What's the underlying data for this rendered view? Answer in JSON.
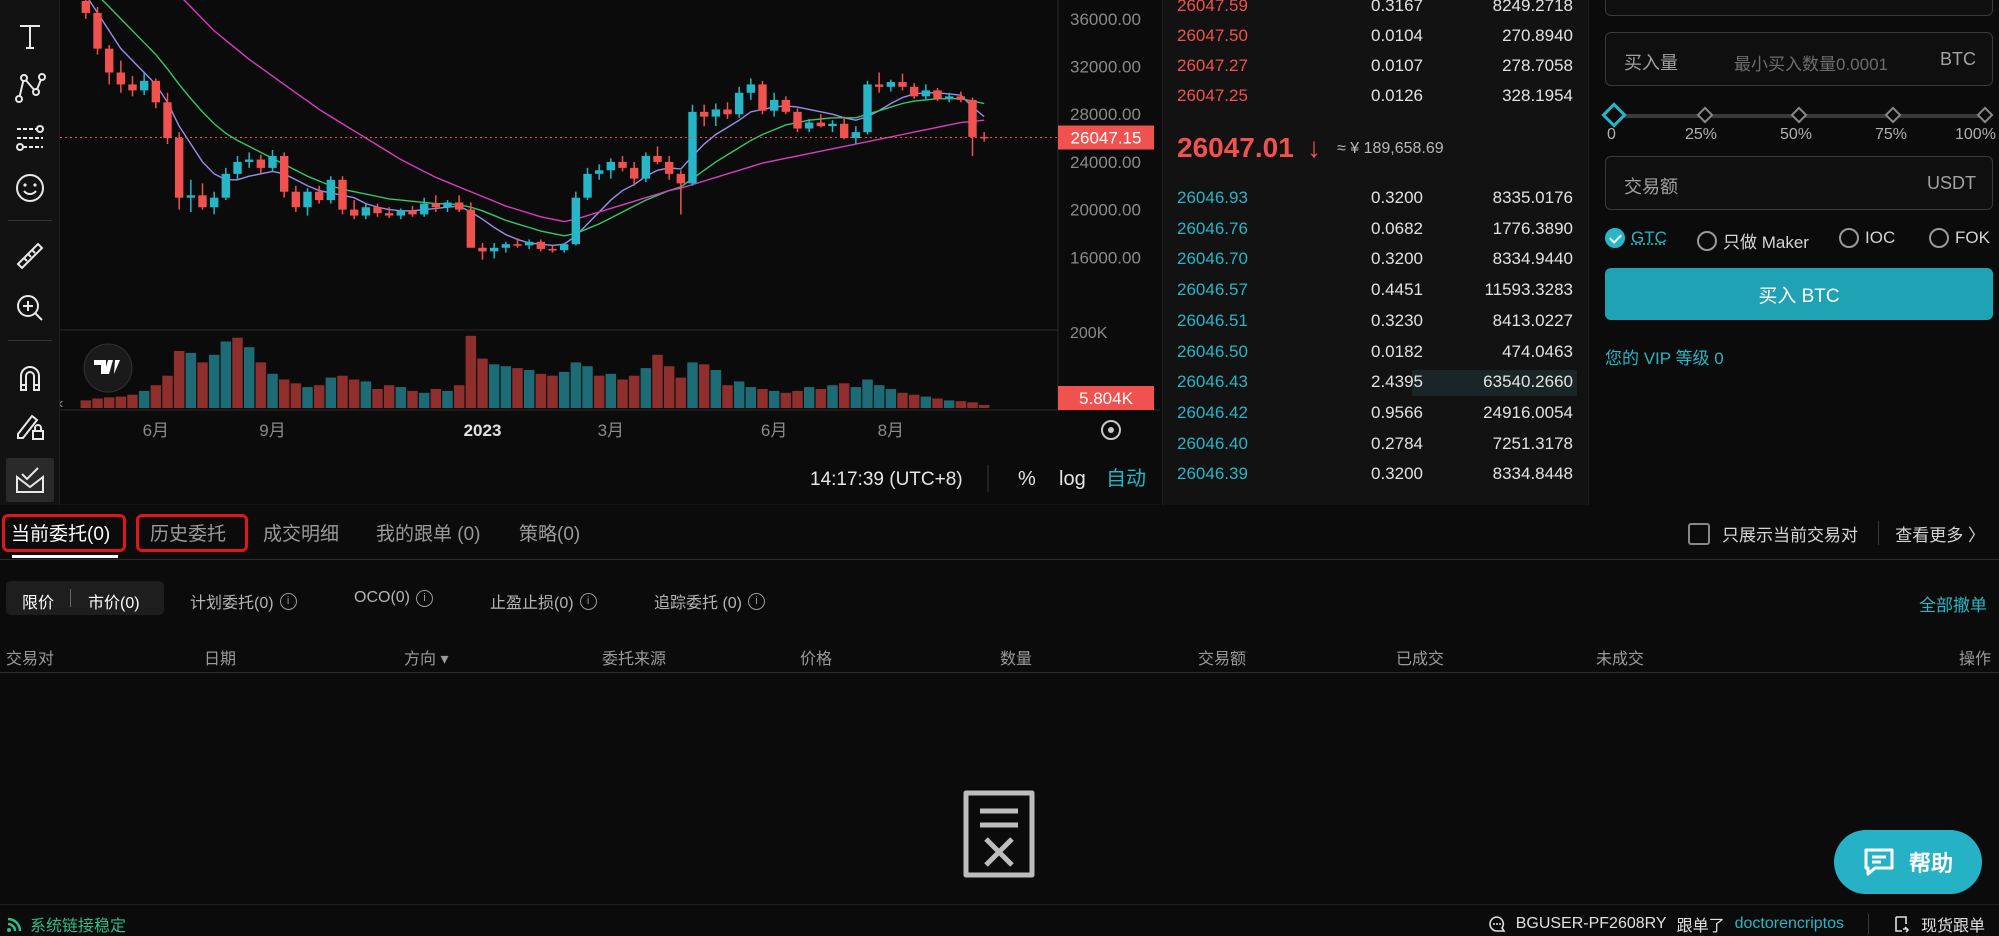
{
  "colors": {
    "up": "#26b6c7",
    "down": "#f0524f",
    "accent": "#26b6c7",
    "red_box": "#e0161b"
  },
  "toolbar": {
    "icons": [
      "text-icon",
      "node-path-icon",
      "fib-lines-icon",
      "smiley-icon",
      "ruler-icon",
      "zoom-in-icon",
      "magnet-icon",
      "pencil-lock-icon",
      "envelope-icon"
    ]
  },
  "chart": {
    "price_axis": [
      "36000.00",
      "32000.00",
      "28000.00",
      "24000.00",
      "20000.00",
      "16000.00"
    ],
    "last_price_label": "26047.15",
    "volume_axis_label": "200K",
    "volume_label": "5.804K",
    "time_axis": [
      "6月",
      "9月",
      "2023",
      "3月",
      "6月",
      "8月"
    ],
    "clock": "14:17:39 (UTC+8)",
    "scale_buttons": [
      "%",
      "log",
      "自动"
    ]
  },
  "chart_data": {
    "type": "candlestick",
    "ylim": [
      14000,
      37000
    ],
    "candles": [
      {
        "o": 37500,
        "h": 38500,
        "l": 36000,
        "c": 36500
      },
      {
        "o": 36500,
        "h": 37000,
        "l": 33000,
        "c": 33500
      },
      {
        "o": 33500,
        "h": 33800,
        "l": 30500,
        "c": 31500
      },
      {
        "o": 31500,
        "h": 32500,
        "l": 29800,
        "c": 30500
      },
      {
        "o": 30500,
        "h": 31200,
        "l": 29500,
        "c": 30000
      },
      {
        "o": 30000,
        "h": 31500,
        "l": 29600,
        "c": 30800
      },
      {
        "o": 30800,
        "h": 31000,
        "l": 28500,
        "c": 29000
      },
      {
        "o": 29000,
        "h": 29800,
        "l": 25500,
        "c": 26000
      },
      {
        "o": 26000,
        "h": 26500,
        "l": 20000,
        "c": 21000
      },
      {
        "o": 21000,
        "h": 22500,
        "l": 19800,
        "c": 21200
      },
      {
        "o": 21200,
        "h": 22200,
        "l": 20000,
        "c": 20200
      },
      {
        "o": 20200,
        "h": 21500,
        "l": 19600,
        "c": 21000
      },
      {
        "o": 21000,
        "h": 23500,
        "l": 20800,
        "c": 23000
      },
      {
        "o": 23000,
        "h": 24500,
        "l": 22500,
        "c": 24000
      },
      {
        "o": 24000,
        "h": 24800,
        "l": 23500,
        "c": 24200
      },
      {
        "o": 24200,
        "h": 24600,
        "l": 23000,
        "c": 23500
      },
      {
        "o": 23500,
        "h": 25000,
        "l": 23200,
        "c": 24500
      },
      {
        "o": 24500,
        "h": 24800,
        "l": 21000,
        "c": 21500
      },
      {
        "o": 21500,
        "h": 22000,
        "l": 19800,
        "c": 20200
      },
      {
        "o": 20200,
        "h": 21800,
        "l": 19500,
        "c": 21500
      },
      {
        "o": 21500,
        "h": 22000,
        "l": 20500,
        "c": 20800
      },
      {
        "o": 20800,
        "h": 22800,
        "l": 20500,
        "c": 22500
      },
      {
        "o": 22500,
        "h": 22800,
        "l": 19600,
        "c": 20000
      },
      {
        "o": 20000,
        "h": 20800,
        "l": 19200,
        "c": 19500
      },
      {
        "o": 19500,
        "h": 20500,
        "l": 19200,
        "c": 20200
      },
      {
        "o": 20200,
        "h": 20500,
        "l": 19400,
        "c": 19700
      },
      {
        "o": 19700,
        "h": 20200,
        "l": 19300,
        "c": 19500
      },
      {
        "o": 19500,
        "h": 20100,
        "l": 19200,
        "c": 19900
      },
      {
        "o": 19900,
        "h": 20300,
        "l": 19400,
        "c": 19600
      },
      {
        "o": 19600,
        "h": 21000,
        "l": 19400,
        "c": 20500
      },
      {
        "o": 20500,
        "h": 21200,
        "l": 19800,
        "c": 20200
      },
      {
        "o": 20200,
        "h": 20800,
        "l": 19800,
        "c": 20600
      },
      {
        "o": 20600,
        "h": 21200,
        "l": 19800,
        "c": 20000
      },
      {
        "o": 20000,
        "h": 20600,
        "l": 17500,
        "c": 16800
      },
      {
        "o": 16800,
        "h": 17200,
        "l": 15800,
        "c": 16500
      },
      {
        "o": 16500,
        "h": 17200,
        "l": 15900,
        "c": 16800
      },
      {
        "o": 16800,
        "h": 17300,
        "l": 16400,
        "c": 17100
      },
      {
        "o": 17100,
        "h": 17600,
        "l": 16800,
        "c": 17000
      },
      {
        "o": 17000,
        "h": 17500,
        "l": 16700,
        "c": 17300
      },
      {
        "o": 17300,
        "h": 17500,
        "l": 16500,
        "c": 16700
      },
      {
        "o": 16700,
        "h": 17000,
        "l": 16400,
        "c": 16600
      },
      {
        "o": 16600,
        "h": 17200,
        "l": 16400,
        "c": 17100
      },
      {
        "o": 17100,
        "h": 21500,
        "l": 17000,
        "c": 21000
      },
      {
        "o": 21000,
        "h": 23500,
        "l": 20800,
        "c": 23000
      },
      {
        "o": 23000,
        "h": 23800,
        "l": 22500,
        "c": 23300
      },
      {
        "o": 23300,
        "h": 24300,
        "l": 22600,
        "c": 24000
      },
      {
        "o": 24000,
        "h": 24500,
        "l": 23200,
        "c": 23500
      },
      {
        "o": 23500,
        "h": 24000,
        "l": 22000,
        "c": 22600
      },
      {
        "o": 22600,
        "h": 24800,
        "l": 22300,
        "c": 24500
      },
      {
        "o": 24500,
        "h": 25300,
        "l": 23800,
        "c": 24000
      },
      {
        "o": 24000,
        "h": 24500,
        "l": 22500,
        "c": 23000
      },
      {
        "o": 23000,
        "h": 23300,
        "l": 19600,
        "c": 22200
      },
      {
        "o": 22200,
        "h": 28800,
        "l": 22000,
        "c": 28200
      },
      {
        "o": 28200,
        "h": 28800,
        "l": 27000,
        "c": 27800
      },
      {
        "o": 27800,
        "h": 28900,
        "l": 27000,
        "c": 28400
      },
      {
        "o": 28400,
        "h": 29000,
        "l": 27600,
        "c": 28000
      },
      {
        "o": 28000,
        "h": 30300,
        "l": 27700,
        "c": 29800
      },
      {
        "o": 29800,
        "h": 31000,
        "l": 29200,
        "c": 30500
      },
      {
        "o": 30500,
        "h": 30800,
        "l": 28000,
        "c": 28300
      },
      {
        "o": 28300,
        "h": 29800,
        "l": 27800,
        "c": 29200
      },
      {
        "o": 29200,
        "h": 29500,
        "l": 28000,
        "c": 28200
      },
      {
        "o": 28200,
        "h": 28500,
        "l": 26500,
        "c": 26800
      },
      {
        "o": 26800,
        "h": 27600,
        "l": 26500,
        "c": 27300
      },
      {
        "o": 27300,
        "h": 28000,
        "l": 26900,
        "c": 27000
      },
      {
        "o": 27000,
        "h": 27500,
        "l": 26500,
        "c": 27200
      },
      {
        "o": 27200,
        "h": 27800,
        "l": 25900,
        "c": 26000
      },
      {
        "o": 26000,
        "h": 27000,
        "l": 25500,
        "c": 26500
      },
      {
        "o": 26500,
        "h": 30800,
        "l": 26300,
        "c": 30500
      },
      {
        "o": 30500,
        "h": 31500,
        "l": 29800,
        "c": 30300
      },
      {
        "o": 30300,
        "h": 30900,
        "l": 29900,
        "c": 30700
      },
      {
        "o": 30700,
        "h": 31400,
        "l": 30000,
        "c": 30300
      },
      {
        "o": 30300,
        "h": 30600,
        "l": 29300,
        "c": 29500
      },
      {
        "o": 29500,
        "h": 30500,
        "l": 29200,
        "c": 30000
      },
      {
        "o": 30000,
        "h": 30200,
        "l": 29100,
        "c": 29300
      },
      {
        "o": 29300,
        "h": 29800,
        "l": 29000,
        "c": 29500
      },
      {
        "o": 29500,
        "h": 29900,
        "l": 29000,
        "c": 29200
      },
      {
        "o": 29200,
        "h": 29400,
        "l": 24500,
        "c": 26100
      },
      {
        "o": 26100,
        "h": 26500,
        "l": 25700,
        "c": 26000
      }
    ],
    "volume": [
      {
        "v": 20,
        "up": false
      },
      {
        "v": 25,
        "up": false
      },
      {
        "v": 28,
        "up": false
      },
      {
        "v": 30,
        "up": false
      },
      {
        "v": 35,
        "up": false
      },
      {
        "v": 45,
        "up": true
      },
      {
        "v": 60,
        "up": false
      },
      {
        "v": 85,
        "up": false
      },
      {
        "v": 150,
        "up": false
      },
      {
        "v": 145,
        "up": true
      },
      {
        "v": 120,
        "up": false
      },
      {
        "v": 140,
        "up": true
      },
      {
        "v": 175,
        "up": true
      },
      {
        "v": 185,
        "up": false
      },
      {
        "v": 160,
        "up": true
      },
      {
        "v": 120,
        "up": false
      },
      {
        "v": 90,
        "up": true
      },
      {
        "v": 75,
        "up": false
      },
      {
        "v": 65,
        "up": false
      },
      {
        "v": 55,
        "up": true
      },
      {
        "v": 60,
        "up": false
      },
      {
        "v": 80,
        "up": true
      },
      {
        "v": 85,
        "up": false
      },
      {
        "v": 75,
        "up": false
      },
      {
        "v": 70,
        "up": true
      },
      {
        "v": 50,
        "up": false
      },
      {
        "v": 60,
        "up": false
      },
      {
        "v": 55,
        "up": true
      },
      {
        "v": 45,
        "up": false
      },
      {
        "v": 40,
        "up": true
      },
      {
        "v": 50,
        "up": false
      },
      {
        "v": 45,
        "up": true
      },
      {
        "v": 60,
        "up": false
      },
      {
        "v": 190,
        "up": false
      },
      {
        "v": 130,
        "up": false
      },
      {
        "v": 115,
        "up": true
      },
      {
        "v": 110,
        "up": true
      },
      {
        "v": 105,
        "up": false
      },
      {
        "v": 100,
        "up": true
      },
      {
        "v": 90,
        "up": false
      },
      {
        "v": 85,
        "up": false
      },
      {
        "v": 95,
        "up": true
      },
      {
        "v": 120,
        "up": true
      },
      {
        "v": 110,
        "up": true
      },
      {
        "v": 85,
        "up": false
      },
      {
        "v": 90,
        "up": true
      },
      {
        "v": 75,
        "up": false
      },
      {
        "v": 85,
        "up": false
      },
      {
        "v": 105,
        "up": true
      },
      {
        "v": 140,
        "up": false
      },
      {
        "v": 110,
        "up": false
      },
      {
        "v": 80,
        "up": false
      },
      {
        "v": 120,
        "up": true
      },
      {
        "v": 115,
        "up": false
      },
      {
        "v": 100,
        "up": true
      },
      {
        "v": 60,
        "up": false
      },
      {
        "v": 70,
        "up": true
      },
      {
        "v": 55,
        "up": true
      },
      {
        "v": 50,
        "up": false
      },
      {
        "v": 45,
        "up": true
      },
      {
        "v": 40,
        "up": false
      },
      {
        "v": 45,
        "up": false
      },
      {
        "v": 55,
        "up": true
      },
      {
        "v": 50,
        "up": false
      },
      {
        "v": 60,
        "up": true
      },
      {
        "v": 65,
        "up": false
      },
      {
        "v": 55,
        "up": true
      },
      {
        "v": 75,
        "up": true
      },
      {
        "v": 60,
        "up": true
      },
      {
        "v": 50,
        "up": true
      },
      {
        "v": 40,
        "up": false
      },
      {
        "v": 35,
        "up": false
      },
      {
        "v": 30,
        "up": true
      },
      {
        "v": 25,
        "up": false
      },
      {
        "v": 20,
        "up": true
      },
      {
        "v": 18,
        "up": false
      },
      {
        "v": 15,
        "up": false
      },
      {
        "v": 8,
        "up": false
      }
    ],
    "ma_lines": [
      {
        "color": "#9b8cf0",
        "values": [
          38000,
          36500,
          35000,
          33500,
          32500,
          31500,
          30500,
          29000,
          27000,
          25500,
          24000,
          23000,
          22500,
          22500,
          22800,
          23000,
          23200,
          23000,
          22500,
          22000,
          21600,
          21400,
          21200,
          21000,
          20500,
          20200,
          20000,
          19900,
          19900,
          20000,
          20100,
          20200,
          20300,
          19800,
          19200,
          18500,
          17900,
          17500,
          17200,
          17100,
          17000,
          17100,
          17800,
          18800,
          19800,
          20800,
          21600,
          22100,
          22800,
          23300,
          23500,
          23400,
          24500,
          25500,
          26300,
          26900,
          27500,
          28200,
          28400,
          28600,
          28700,
          28600,
          28400,
          28200,
          28000,
          27700,
          27500,
          27800,
          28300,
          28900,
          29400,
          29700,
          29800,
          29800,
          29700,
          29600,
          28600,
          27800
        ]
      },
      {
        "color": "#35c76a",
        "values": [
          39000,
          38000,
          37000,
          36000,
          35000,
          34000,
          33000,
          31800,
          30500,
          29300,
          28200,
          27200,
          26400,
          25800,
          25300,
          24800,
          24300,
          23800,
          23300,
          22800,
          22400,
          22000,
          21700,
          21500,
          21300,
          21100,
          20900,
          20800,
          20700,
          20600,
          20500,
          20500,
          20400,
          20200,
          19900,
          19500,
          19100,
          18800,
          18500,
          18200,
          18000,
          17800,
          18000,
          18400,
          18800,
          19300,
          19800,
          20300,
          20800,
          21200,
          21600,
          21900,
          22600,
          23300,
          24000,
          24600,
          25200,
          25800,
          26300,
          26700,
          27100,
          27300,
          27500,
          27600,
          27700,
          27700,
          27700,
          28000,
          28300,
          28600,
          28900,
          29100,
          29200,
          29300,
          29300,
          29300,
          29100,
          28900
        ]
      },
      {
        "color": "#d63fbd",
        "values": [
          46000,
          45000,
          44000,
          43000,
          42000,
          41000,
          40000,
          39000,
          38000,
          37000,
          36000,
          35000,
          34200,
          33400,
          32600,
          31900,
          31200,
          30500,
          29800,
          29100,
          28400,
          27800,
          27200,
          26600,
          26000,
          25400,
          24800,
          24200,
          23700,
          23200,
          22700,
          22300,
          21900,
          21500,
          21100,
          20700,
          20300,
          20000,
          19700,
          19400,
          19200,
          19000,
          19200,
          19500,
          19800,
          20100,
          20400,
          20700,
          21000,
          21300,
          21600,
          21800,
          22100,
          22400,
          22700,
          23000,
          23300,
          23600,
          23900,
          24100,
          24300,
          24500,
          24700,
          24900,
          25100,
          25300,
          25500,
          25700,
          25900,
          26100,
          26300,
          26500,
          26700,
          26900,
          27100,
          27300,
          27400,
          27500
        ]
      }
    ]
  },
  "orderbook": {
    "asks": [
      {
        "price": "26047.59",
        "qty": "0.3167",
        "total": "8249.2718"
      },
      {
        "price": "26047.50",
        "qty": "0.0104",
        "total": "270.8940"
      },
      {
        "price": "26047.27",
        "qty": "0.0107",
        "total": "278.7058"
      },
      {
        "price": "26047.25",
        "qty": "0.0126",
        "total": "328.1954"
      }
    ],
    "mid": {
      "price": "26047.01",
      "arrow": "↓",
      "fiat": "≈ ¥  189,658.69"
    },
    "bids": [
      {
        "price": "26046.93",
        "qty": "0.3200",
        "total": "8335.0176",
        "depth": 0
      },
      {
        "price": "26046.76",
        "qty": "0.0682",
        "total": "1776.3890",
        "depth": 0
      },
      {
        "price": "26046.70",
        "qty": "0.3200",
        "total": "8334.9440",
        "depth": 0
      },
      {
        "price": "26046.57",
        "qty": "0.4451",
        "total": "11593.3283",
        "depth": 0
      },
      {
        "price": "26046.51",
        "qty": "0.3230",
        "total": "8413.0227",
        "depth": 0
      },
      {
        "price": "26046.50",
        "qty": "0.0182",
        "total": "474.0463",
        "depth": 0
      },
      {
        "price": "26046.43",
        "qty": "2.4395",
        "total": "63540.2660",
        "depth": 1
      },
      {
        "price": "26046.42",
        "qty": "0.9566",
        "total": "24916.0054",
        "depth": 0
      },
      {
        "price": "26046.40",
        "qty": "0.2784",
        "total": "7251.3178",
        "depth": 0
      },
      {
        "price": "26046.39",
        "qty": "0.3200",
        "total": "8334.8448",
        "depth": 0
      }
    ]
  },
  "trade": {
    "amount_label": "买入量",
    "amount_placeholder": "最小买入数量0.0001",
    "amount_unit": "BTC",
    "slider_labels": [
      "0",
      "25%",
      "50%",
      "75%",
      "100%"
    ],
    "slider_value": 0,
    "total_label": "交易额",
    "total_unit": "USDT",
    "tif": [
      "GTC",
      "只做 Maker",
      "IOC",
      "FOK"
    ],
    "buy_button": "买入 BTC",
    "vip": "您的 VIP 等级 0"
  },
  "tabs": {
    "items": [
      "当前委托(0)",
      "历史委托",
      "成交明细",
      "我的跟单 (0)",
      "策略(0)"
    ],
    "only_current": "只展示当前交易对",
    "view_more": "查看更多 〉"
  },
  "subtabs": {
    "limit": "限价",
    "market": "市价(0)",
    "items": [
      "计划委托(0)",
      "OCO(0)",
      "止盈止损(0)",
      "追踪委托 (0)"
    ],
    "cancel_all": "全部撤单"
  },
  "columns": [
    "交易对",
    "日期",
    "方向 ▾",
    "委托来源",
    "价格",
    "数量",
    "交易额",
    "已成交",
    "未成交",
    "操作"
  ],
  "status": {
    "ok": "系统链接稳定",
    "user": "BGUSER-PF2608RY",
    "followed": "跟单了",
    "trader": "doctorencriptos",
    "spot_copy": "现货跟单"
  },
  "help": "帮助"
}
